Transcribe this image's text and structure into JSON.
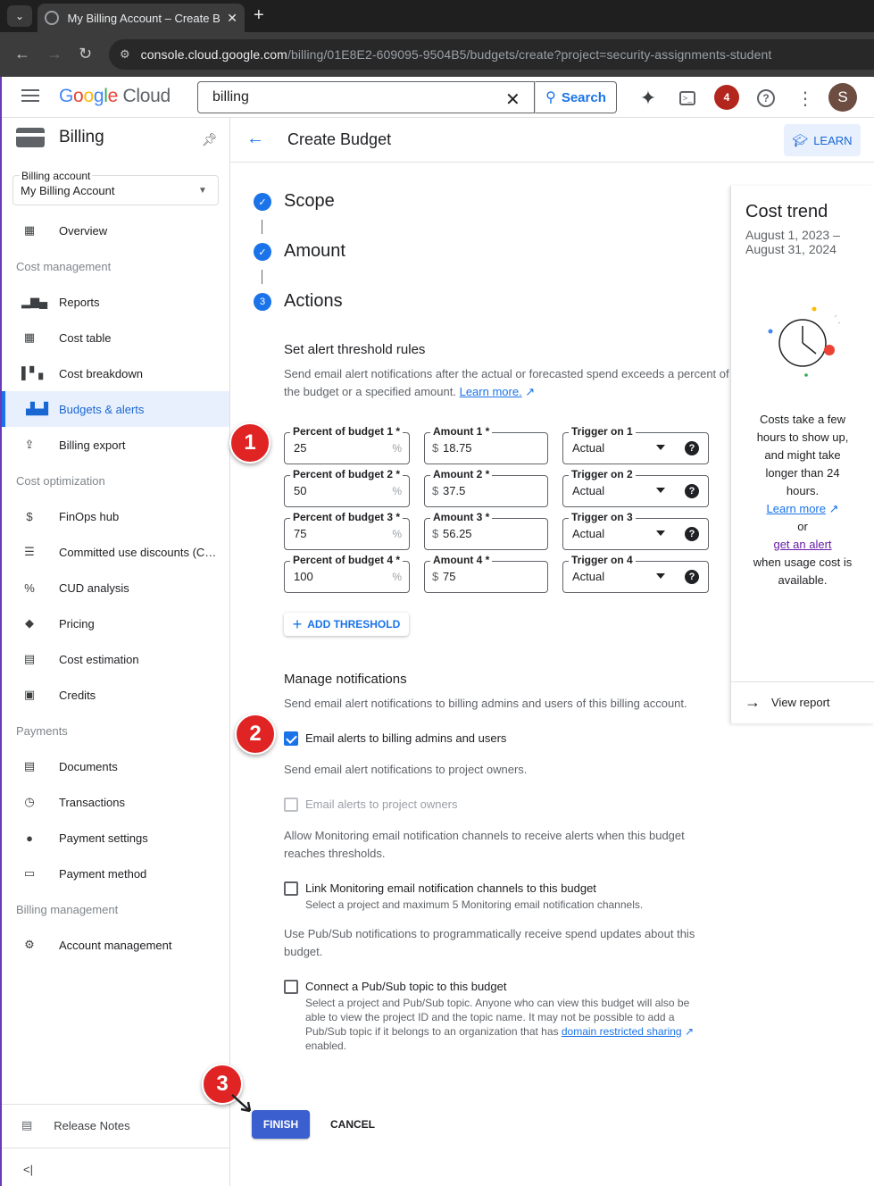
{
  "browser": {
    "tab_title": "My Billing Account – Create B",
    "url_host": "console.cloud.google.com",
    "url_path": "/billing/01E8E2-609095-9504B5/budgets/create?project=security-assignments-student"
  },
  "topbar": {
    "logo_g": "G",
    "logo_o1": "o",
    "logo_o2": "o",
    "logo_g2": "g",
    "logo_l": "l",
    "logo_e": "e",
    "logo_cloud": " Cloud",
    "search_value": "billing",
    "search_button": "Search",
    "notification_count": "4",
    "avatar_letter": "S"
  },
  "sidebar": {
    "title": "Billing",
    "account_label": "Billing account",
    "account_value": "My Billing Account",
    "overview": "Overview",
    "sections": {
      "cost_management": "Cost management",
      "cost_optimization": "Cost optimization",
      "payments": "Payments",
      "billing_management": "Billing management"
    },
    "items": {
      "reports": "Reports",
      "cost_table": "Cost table",
      "cost_breakdown": "Cost breakdown",
      "budgets_alerts": "Budgets & alerts",
      "billing_export": "Billing export",
      "finops_hub": "FinOps hub",
      "committed_use": "Committed use discounts (C…",
      "cud_analysis": "CUD analysis",
      "pricing": "Pricing",
      "cost_estimation": "Cost estimation",
      "credits": "Credits",
      "documents": "Documents",
      "transactions": "Transactions",
      "payment_settings": "Payment settings",
      "payment_method": "Payment method",
      "account_management": "Account management"
    },
    "release_notes": "Release Notes",
    "collapse_glyph": "<|"
  },
  "header": {
    "title": "Create Budget",
    "learn": "LEARN"
  },
  "steps": {
    "scope": "Scope",
    "amount": "Amount",
    "actions": "Actions",
    "actions_number": "3"
  },
  "thresholds": {
    "heading": "Set alert threshold rules",
    "description_1": "Send email alert notifications after the actual or forecasted spend exceeds a percent of",
    "description_2": "the budget or a specified amount.",
    "learn_more": "Learn more.",
    "rows": [
      {
        "pct_label": "Percent of budget 1 *",
        "pct": "25",
        "amt_label": "Amount 1 *",
        "amt": "18.75",
        "trig_label": "Trigger on 1",
        "trig": "Actual"
      },
      {
        "pct_label": "Percent of budget 2 *",
        "pct": "50",
        "amt_label": "Amount 2 *",
        "amt": "37.5",
        "trig_label": "Trigger on 2",
        "trig": "Actual"
      },
      {
        "pct_label": "Percent of budget 3 *",
        "pct": "75",
        "amt_label": "Amount 3 *",
        "amt": "56.25",
        "trig_label": "Trigger on 3",
        "trig": "Actual"
      },
      {
        "pct_label": "Percent of budget 4 *",
        "pct": "100",
        "amt_label": "Amount 4 *",
        "amt": "75",
        "trig_label": "Trigger on 4",
        "trig": "Actual"
      }
    ],
    "pct_suffix": "%",
    "currency": "$",
    "add_threshold": "ADD THRESHOLD"
  },
  "notifications": {
    "heading": "Manage notifications",
    "billing_admins_desc": "Send email alert notifications to billing admins and users of this billing account.",
    "billing_admins_label": "Email alerts to billing admins and users",
    "project_owners_desc": "Send email alert notifications to project owners.",
    "project_owners_label": "Email alerts to project owners",
    "monitoring_desc_1": "Allow Monitoring email notification channels to receive alerts when this budget",
    "monitoring_desc_2": "reaches thresholds.",
    "monitoring_label": "Link Monitoring email notification channels to this budget",
    "monitoring_sub": "Select a project and maximum 5 Monitoring email notification channels.",
    "pubsub_desc_1": "Use Pub/Sub notifications to programmatically receive spend updates about this",
    "pubsub_desc_2": "budget.",
    "pubsub_label": "Connect a Pub/Sub topic to this budget",
    "pubsub_sub_1": "Select a project and Pub/Sub topic. Anyone who can view this budget will also be",
    "pubsub_sub_2": "able to view the project ID and the topic name. It may not be possible to add a",
    "pubsub_sub_3": "Pub/Sub topic if it belongs to an organization that has",
    "pubsub_sub_link": "domain restricted sharing",
    "pubsub_sub_4": "enabled."
  },
  "actions": {
    "finish": "FINISH",
    "cancel": "CANCEL"
  },
  "annotations": {
    "badge_1": "1",
    "badge_2": "2",
    "badge_3": "3"
  },
  "cost_trend": {
    "title": "Cost trend",
    "date_line_1": "August 1, 2023 –",
    "date_line_2": "August 31, 2024",
    "text_1": "Costs take a few hours to show up, and might take longer than 24 hours.",
    "learn_more": "Learn more",
    "or": "or",
    "get_alert": "get an alert",
    "text_2": "when usage cost is available.",
    "view_report": "View report"
  },
  "colors": {
    "accent": "#1a73e8",
    "badge_red": "#e02424",
    "finish_blue": "#3b5fcf"
  }
}
